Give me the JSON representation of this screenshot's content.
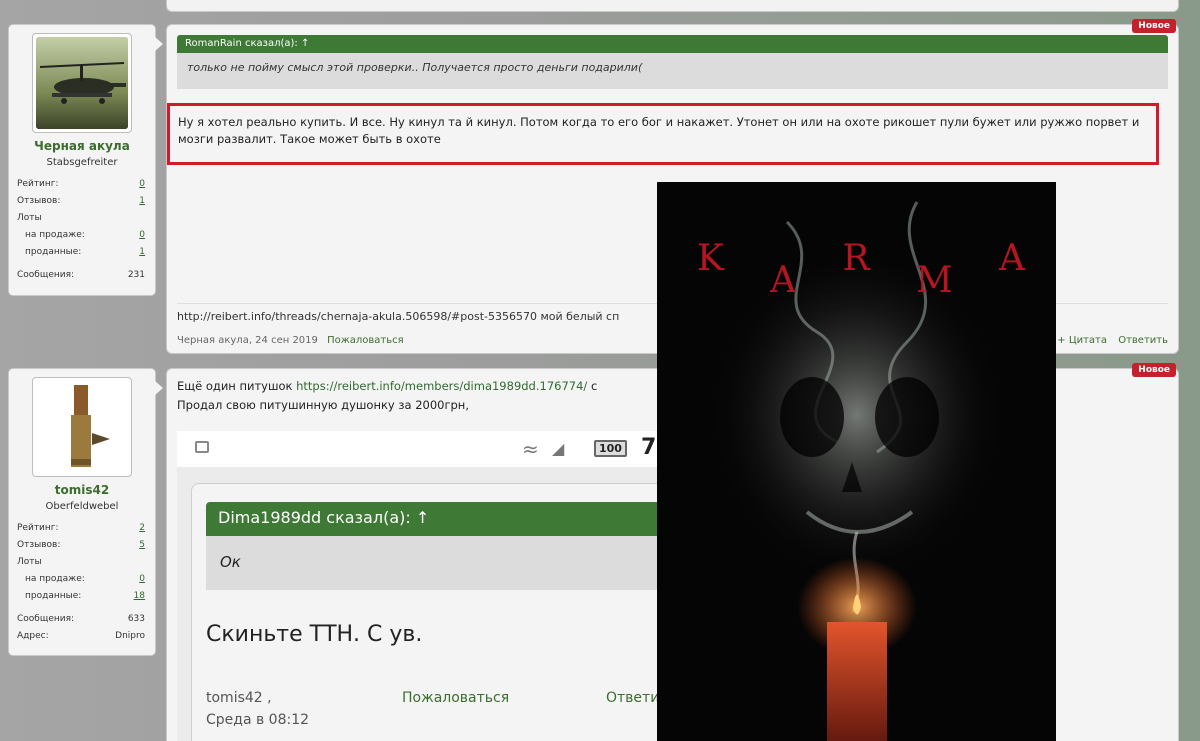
{
  "badge_new": "Новое",
  "post1": {
    "user": {
      "name": "Черная акула",
      "title": "Stabsgefreiter",
      "stats": {
        "rating_label": "Рейтинг:",
        "rating": "0",
        "reviews_label": "Отзывов:",
        "reviews": "1",
        "lots_label": "Лоты",
        "on_sale_label": "на продаже:",
        "on_sale": "0",
        "sold_label": "проданные:",
        "sold": "1",
        "messages_label": "Сообщения:",
        "messages": "231"
      }
    },
    "quote_author": "RomanRain сказал(а): ↑",
    "quote_text": "только не пойму смысл этой проверки.. Получается просто деньги подарили(",
    "message": "Ну я хотел реально купить. И все. Ну кинул та й кинул. Потом когда то его бог и накажет. Утонет он или на охоте рикошет пули бужет или ружжо порвет и мозги развалит. Такое может быть в охоте",
    "signature": "http://reibert.info/threads/chernaja-akula.506598/#post-5356570 мой белый сп",
    "meta": "Черная акула, 24 сен 2019",
    "report": "Пожаловаться",
    "quote_btn": "+ Цитата",
    "reply_btn": "Ответить"
  },
  "post2": {
    "user": {
      "name": "tomis42",
      "title": "Oberfeldwebel",
      "stats": {
        "rating_label": "Рейтинг:",
        "rating": "2",
        "reviews_label": "Отзывов:",
        "reviews": "5",
        "lots_label": "Лоты",
        "on_sale_label": "на продаже:",
        "on_sale": "0",
        "sold_label": "проданные:",
        "sold": "18",
        "messages_label": "Сообщения:",
        "messages": "633",
        "address_label": "Адрес:",
        "address": "Dnipro"
      }
    },
    "line1_prefix": "Ещё один питушок",
    "line1_link": "https://reibert.info/members/dima1989dd.176774/",
    "line1_suffix": "с",
    "line2": "Продал свою питушинную душонку за 2000грн,",
    "phone": {
      "battery": "100",
      "time": "7",
      "quote_author": "Dima1989dd сказал(а): ↑",
      "quote_text": "Ок",
      "message": "Скиньте ТТН. С ув.",
      "foot_user": "tomis42   ,",
      "foot_time": "Среда в 08:12",
      "report": "Пожаловаться",
      "reply": "Ответи"
    }
  },
  "poster": {
    "letters": [
      "K",
      "A",
      "R",
      "M",
      "A"
    ]
  }
}
